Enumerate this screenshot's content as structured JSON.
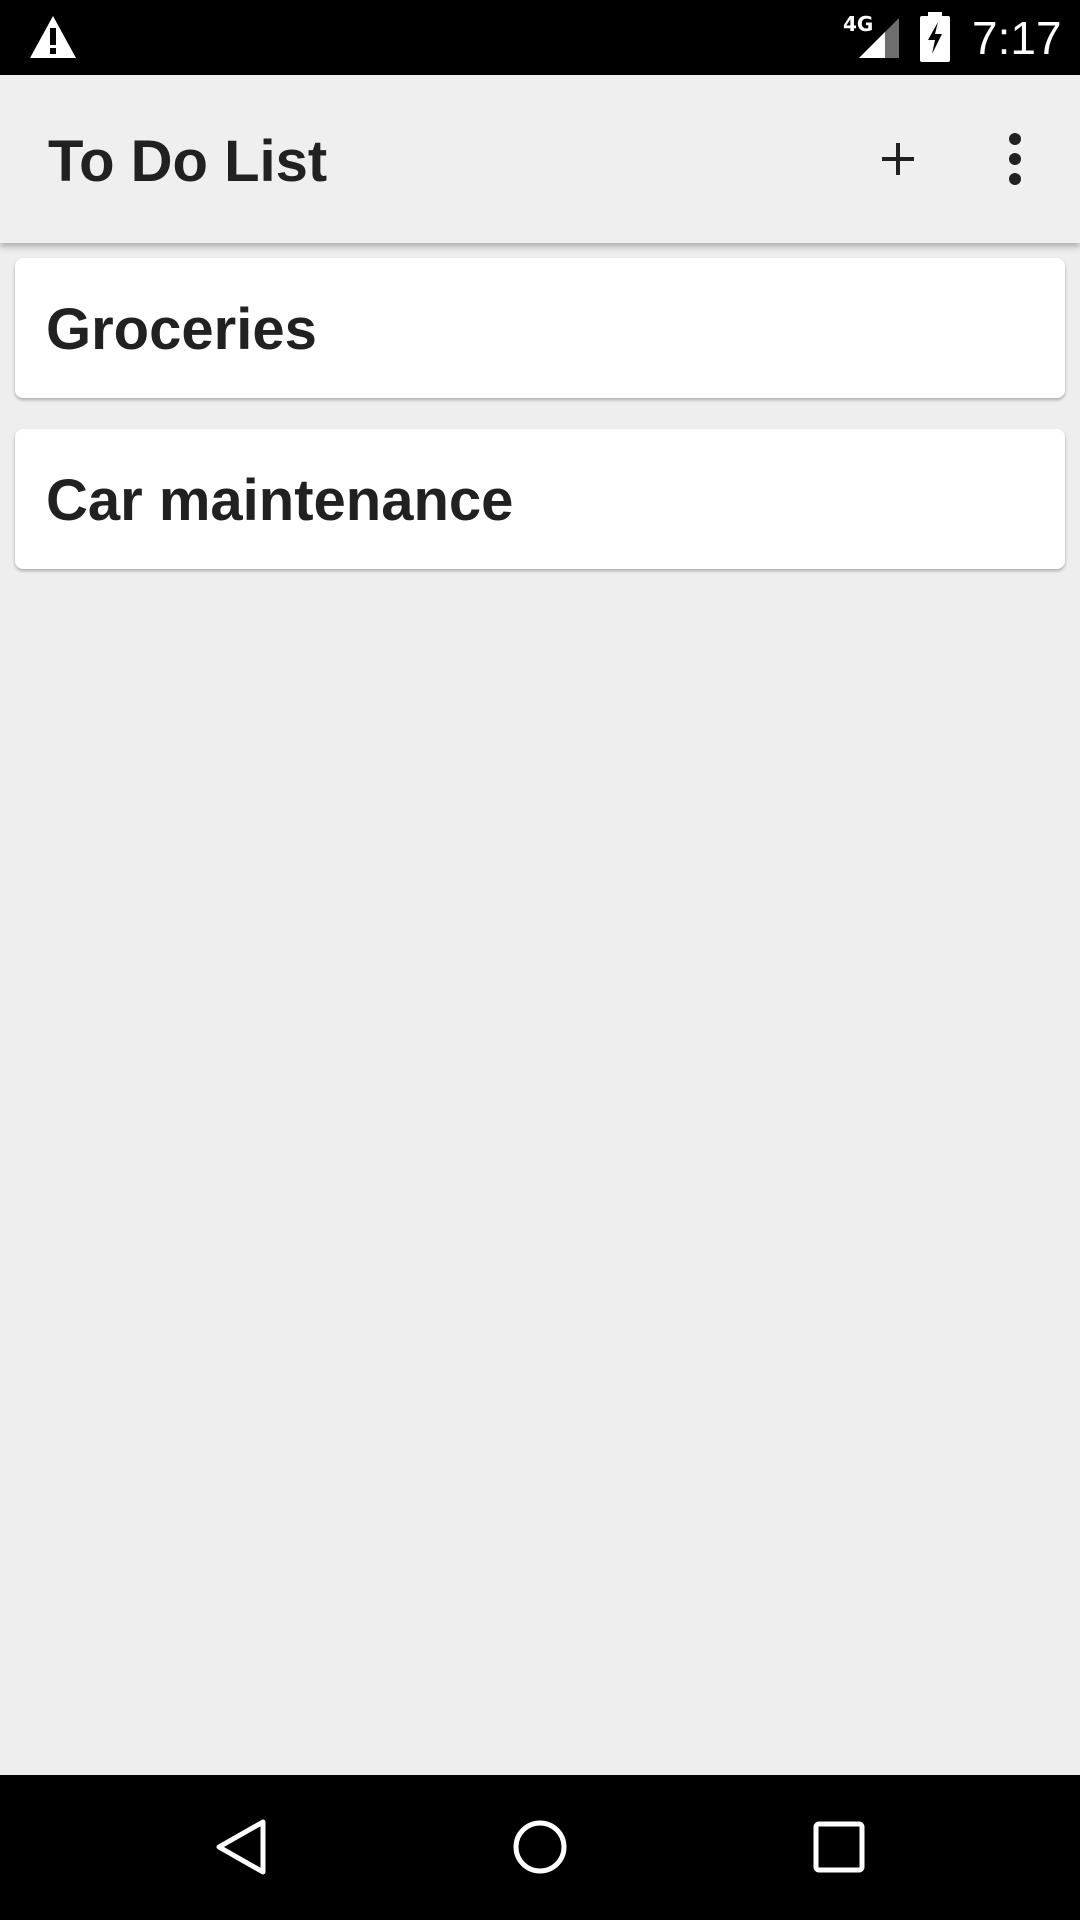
{
  "status_bar": {
    "time": "7:17",
    "network": "4G",
    "icons": [
      "warning-icon",
      "signal-icon",
      "battery-charging-icon"
    ]
  },
  "app_bar": {
    "title": "To Do List",
    "actions": [
      "add-icon",
      "more-vert-icon"
    ]
  },
  "lists": [
    {
      "label": "Groceries"
    },
    {
      "label": "Car maintenance"
    }
  ],
  "nav_bar": {
    "buttons": [
      "back-icon",
      "home-icon",
      "recents-icon"
    ]
  },
  "colors": {
    "background": "#eeeeee",
    "app_bar": "#efefef",
    "card": "#ffffff",
    "text": "#212121",
    "system_bars": "#000000"
  }
}
